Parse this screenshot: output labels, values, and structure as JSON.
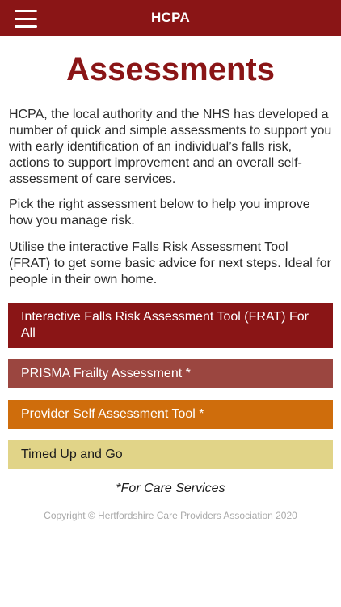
{
  "header": {
    "title": "HCPA",
    "menu_icon": "hamburger-menu-icon",
    "background_color": "#8a1516"
  },
  "main": {
    "title": "Assessments",
    "paragraphs": [
      "HCPA, the local authority and the NHS has developed a number of  quick and simple assessments to support you with early identification of an individual’s falls risk, actions to support improvement and an overall self-assessment of care services.",
      "Pick the right assessment below to help you improve how you manage risk.",
      "Utilise the interactive Falls Risk Assessment Tool (FRAT)  to get some basic advice for next steps. Ideal for people in their own home."
    ],
    "buttons": [
      {
        "label": "Interactive Falls Risk Assessment Tool (FRAT) For All",
        "color": "#8a1516"
      },
      {
        "label": "PRISMA Frailty Assessment *",
        "color": "#9b4640"
      },
      {
        "label": "Provider Self Assessment Tool *",
        "color": "#cf6d0c"
      },
      {
        "label": "Timed Up and Go",
        "color": "#e1d488"
      }
    ],
    "note": "*For Care Services",
    "copyright": "Copyright © Hertfordshire Care Providers Association 2020"
  }
}
